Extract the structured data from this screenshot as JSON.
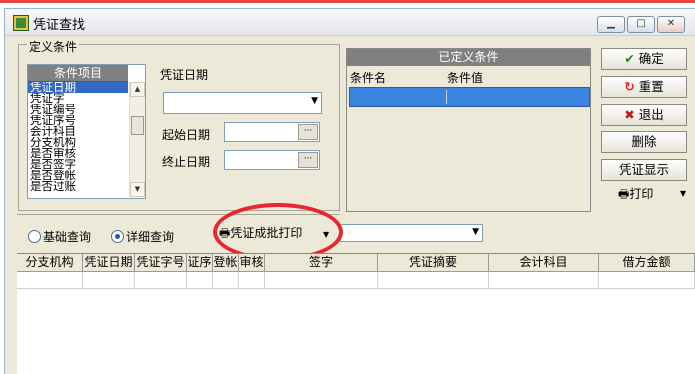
{
  "window": {
    "title": "凭证查找"
  },
  "conditions_group": {
    "legend": "定义条件"
  },
  "item_list": {
    "header": "条件项目",
    "items": [
      "凭证日期",
      "凭证字",
      "凭证编号",
      "凭证序号",
      "会计科目",
      "分支机构",
      "是否审核",
      "是否签字",
      "是否登帐",
      "是否过账"
    ],
    "selected_index": 0
  },
  "date_section": {
    "title": "凭证日期",
    "start_label": "起始日期",
    "end_label": "终止日期",
    "combo_value": "",
    "start_value": "",
    "end_value": "",
    "dots": "···"
  },
  "defined_conditions": {
    "header": "已定义条件",
    "col_name": "条件名",
    "col_value": "条件值"
  },
  "buttons": {
    "ok": "确定",
    "reset": "重置",
    "exit": "退出",
    "delete": "删除",
    "show_voucher": "凭证显示",
    "print": "打印",
    "batch_print": "凭证成批打印"
  },
  "query_mode": {
    "basic": "基础查询",
    "detail": "详细查询",
    "selected": "detail"
  },
  "grid": {
    "columns": [
      "分支机构",
      "凭证日期",
      "凭证字号",
      "证序",
      "登帐",
      "审核",
      "签字",
      "凭证摘要",
      "会计科目",
      "借方金额"
    ]
  },
  "colors": {
    "annotation_circle": "#e8262b",
    "selection": "#3b83e0"
  }
}
